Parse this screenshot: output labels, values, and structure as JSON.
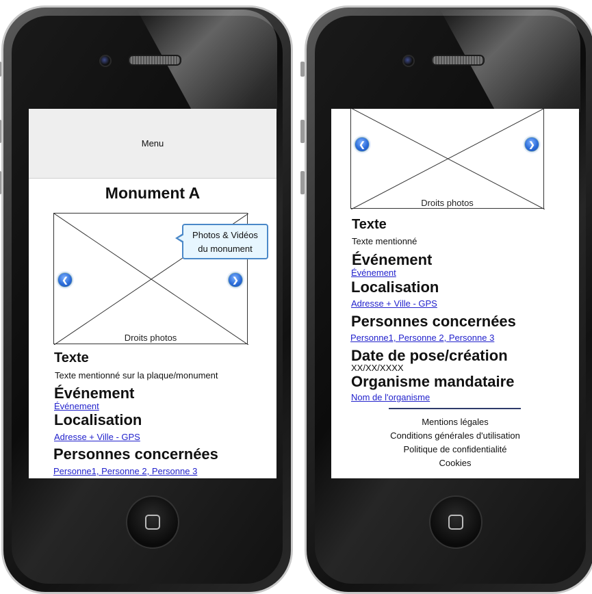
{
  "left_screen": {
    "menu_label": "Menu",
    "title": "Monument A",
    "gallery_caption": "Droits photos",
    "callout_line1": "Photos & Vidéos",
    "callout_line2": "du monument",
    "sections": {
      "texte_heading": "Texte",
      "texte_value": "Texte mentionné sur la plaque/monument",
      "evenement_heading": "Événement",
      "evenement_link": "Événement",
      "localisation_heading": "Localisation",
      "localisation_link": "Adresse + Ville - GPS",
      "personnes_heading": "Personnes concernées",
      "personnes_link": "Personne1, Personne 2, Personne 3"
    }
  },
  "right_screen": {
    "gallery_caption": "Droits photos",
    "sections": {
      "texte_heading": "Texte",
      "texte_value": "Texte mentionné",
      "evenement_heading": "Événement",
      "evenement_link": "Événement",
      "localisation_heading": "Localisation",
      "localisation_link": "Adresse + Ville - GPS",
      "personnes_heading": "Personnes concernées",
      "personnes_link": "Personne1, Personne 2, Personne 3",
      "date_heading": "Date de pose/création",
      "date_value": "XX/XX/XXXX",
      "organisme_heading": "Organisme mandataire",
      "organisme_link": "Nom de l'organisme"
    },
    "footer": {
      "mentions": "Mentions légales",
      "cgu": "Conditions générales d'utilisation",
      "privacy": "Politique de confidentialité",
      "cookies": "Cookies"
    }
  },
  "icons": {
    "prev": "chevron-left-icon",
    "next": "chevron-right-icon",
    "home": "home-button-icon"
  }
}
